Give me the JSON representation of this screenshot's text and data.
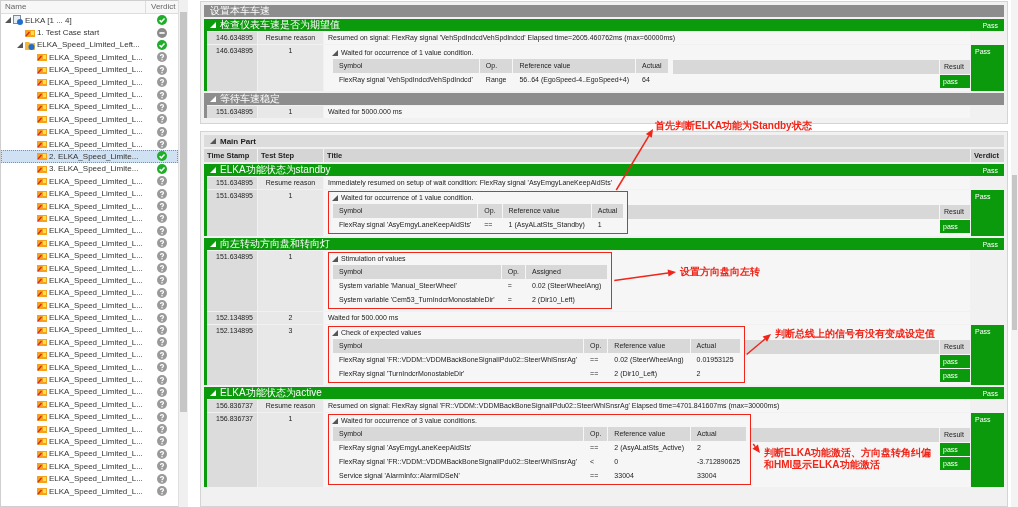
{
  "tree": {
    "columns": [
      "Name",
      "Verdict"
    ],
    "items": [
      {
        "label": "ELKA [1 ... 4]",
        "kind": "module",
        "verdict": {
          "kind": "pass"
        },
        "expanded": true,
        "selected": false,
        "children": [
          {
            "label": "1. Test Case start",
            "kind": "testcase",
            "verdict": {
              "kind": "none"
            },
            "selected": false
          },
          {
            "label": "ELKA_Speed_Limited_Left...",
            "kind": "group",
            "verdict": {
              "kind": "pass"
            },
            "expanded": true,
            "selected": false,
            "children": [
              {
                "label": "ELKA_Speed_Limited_L...",
                "kind": "testcase",
                "verdict": {
                  "kind": "unknown"
                },
                "selected": false
              },
              {
                "label": "ELKA_Speed_Limited_L...",
                "kind": "testcase",
                "verdict": {
                  "kind": "unknown"
                },
                "selected": false
              },
              {
                "label": "ELKA_Speed_Limited_L...",
                "kind": "testcase",
                "verdict": {
                  "kind": "unknown"
                },
                "selected": false
              },
              {
                "label": "ELKA_Speed_Limited_L...",
                "kind": "testcase",
                "verdict": {
                  "kind": "unknown"
                },
                "selected": false
              },
              {
                "label": "ELKA_Speed_Limited_L...",
                "kind": "testcase",
                "verdict": {
                  "kind": "unknown"
                },
                "selected": false
              },
              {
                "label": "ELKA_Speed_Limited_L...",
                "kind": "testcase",
                "verdict": {
                  "kind": "unknown"
                },
                "selected": false
              },
              {
                "label": "ELKA_Speed_Limited_L...",
                "kind": "testcase",
                "verdict": {
                  "kind": "unknown"
                },
                "selected": false
              },
              {
                "label": "ELKA_Speed_Limited_L...",
                "kind": "testcase",
                "verdict": {
                  "kind": "unknown"
                },
                "selected": false
              },
              {
                "label": "2. ELKA_Speed_Limite...",
                "kind": "testcase",
                "verdict": {
                  "kind": "pass"
                },
                "selected": true
              },
              {
                "label": "3. ELKA_Speed_Limite...",
                "kind": "testcase",
                "verdict": {
                  "kind": "pass"
                },
                "selected": false
              },
              {
                "label": "ELKA_Speed_Limited_L...",
                "kind": "testcase",
                "verdict": {
                  "kind": "unknown"
                },
                "selected": false
              },
              {
                "label": "ELKA_Speed_Limited_L...",
                "kind": "testcase",
                "verdict": {
                  "kind": "unknown"
                },
                "selected": false
              },
              {
                "label": "ELKA_Speed_Limited_L...",
                "kind": "testcase",
                "verdict": {
                  "kind": "unknown"
                },
                "selected": false
              },
              {
                "label": "ELKA_Speed_Limited_L...",
                "kind": "testcase",
                "verdict": {
                  "kind": "unknown"
                },
                "selected": false
              },
              {
                "label": "ELKA_Speed_Limited_L...",
                "kind": "testcase",
                "verdict": {
                  "kind": "unknown"
                },
                "selected": false
              },
              {
                "label": "ELKA_Speed_Limited_L...",
                "kind": "testcase",
                "verdict": {
                  "kind": "unknown"
                },
                "selected": false
              },
              {
                "label": "ELKA_Speed_Limited_L...",
                "kind": "testcase",
                "verdict": {
                  "kind": "unknown"
                },
                "selected": false
              },
              {
                "label": "ELKA_Speed_Limited_L...",
                "kind": "testcase",
                "verdict": {
                  "kind": "unknown"
                },
                "selected": false
              },
              {
                "label": "ELKA_Speed_Limited_L...",
                "kind": "testcase",
                "verdict": {
                  "kind": "unknown"
                },
                "selected": false
              },
              {
                "label": "ELKA_Speed_Limited_L...",
                "kind": "testcase",
                "verdict": {
                  "kind": "unknown"
                },
                "selected": false
              },
              {
                "label": "ELKA_Speed_Limited_L...",
                "kind": "testcase",
                "verdict": {
                  "kind": "unknown"
                },
                "selected": false
              },
              {
                "label": "ELKA_Speed_Limited_L...",
                "kind": "testcase",
                "verdict": {
                  "kind": "unknown"
                },
                "selected": false
              },
              {
                "label": "ELKA_Speed_Limited_L...",
                "kind": "testcase",
                "verdict": {
                  "kind": "unknown"
                },
                "selected": false
              },
              {
                "label": "ELKA_Speed_Limited_L...",
                "kind": "testcase",
                "verdict": {
                  "kind": "unknown"
                },
                "selected": false
              },
              {
                "label": "ELKA_Speed_Limited_L...",
                "kind": "testcase",
                "verdict": {
                  "kind": "unknown"
                },
                "selected": false
              },
              {
                "label": "ELKA_Speed_Limited_L...",
                "kind": "testcase",
                "verdict": {
                  "kind": "unknown"
                },
                "selected": false
              },
              {
                "label": "ELKA_Speed_Limited_L...",
                "kind": "testcase",
                "verdict": {
                  "kind": "unknown"
                },
                "selected": false
              },
              {
                "label": "ELKA_Speed_Limited_L...",
                "kind": "testcase",
                "verdict": {
                  "kind": "unknown"
                },
                "selected": false
              },
              {
                "label": "ELKA_Speed_Limited_L...",
                "kind": "testcase",
                "verdict": {
                  "kind": "unknown"
                },
                "selected": false
              },
              {
                "label": "ELKA_Speed_Limited_L...",
                "kind": "testcase",
                "verdict": {
                  "kind": "unknown"
                },
                "selected": false
              },
              {
                "label": "ELKA_Speed_Limited_L...",
                "kind": "testcase",
                "verdict": {
                  "kind": "unknown"
                },
                "selected": false
              },
              {
                "label": "ELKA_Speed_Limited_L...",
                "kind": "testcase",
                "verdict": {
                  "kind": "unknown"
                },
                "selected": false
              },
              {
                "label": "ELKA_Speed_Limited_L...",
                "kind": "testcase",
                "verdict": {
                  "kind": "unknown"
                },
                "selected": false
              },
              {
                "label": "ELKA_Speed_Limited_L...",
                "kind": "testcase",
                "verdict": {
                  "kind": "unknown"
                },
                "selected": false
              },
              {
                "label": "ELKA_Speed_Limited_L...",
                "kind": "testcase",
                "verdict": {
                  "kind": "unknown"
                },
                "selected": false
              },
              {
                "label": "ELKA_Speed_Limited_L...",
                "kind": "testcase",
                "verdict": {
                  "kind": "unknown"
                },
                "selected": false
              }
            ]
          }
        ]
      }
    ]
  },
  "report": {
    "top_sections": [
      {
        "title": "设置本车车速"
      },
      {
        "title": "检查仪表车速是否为期望值",
        "verdict": "Pass",
        "expanded": true,
        "rows": [
          {
            "kind": "info",
            "time": "146.634895",
            "step": "Resume reason",
            "title": "Resumed on signal: FlexRay signal 'VehSpdIndcdVehSpdIndcd' Elapsed time=2605.460762ms (max=60000ms)"
          },
          {
            "kind": "check",
            "time": "146.634895",
            "step": "1",
            "caption": "Waited for occurrence of 1 value condition.",
            "expanded": true,
            "verdict": "Pass",
            "table": {
              "columns": [
                "Symbol",
                "Op.",
                "Reference value",
                "Actual"
              ],
              "result_column": "Result",
              "rows": [
                {
                  "cells": [
                    "FlexRay signal 'VehSpdIndcdVehSpdIndcd'",
                    "Range",
                    "56..64 (EgoSpeed-4..EgoSpeed+4)",
                    "64"
                  ],
                  "result": "pass"
                }
              ]
            }
          }
        ]
      },
      {
        "title": "等待车速稳定",
        "expanded": true,
        "rows": [
          {
            "kind": "info",
            "time": "151.634895",
            "step": "1",
            "title": "Waited for 5000.000 ms"
          }
        ]
      }
    ],
    "main_part": {
      "title": "Main Part",
      "expanded": true,
      "columns": [
        "Time Stamp",
        "Test Step",
        "Title",
        "Verdict"
      ],
      "sections": [
        {
          "title": "ELKA功能状态为standby",
          "verdict": "Pass",
          "expanded": true,
          "rows": [
            {
              "kind": "info",
              "time": "151.634895",
              "step": "Resume reason",
              "title": "Immediately resumed on setup of wait condition: FlexRay signal 'AsyEmgyLaneKeepAidSts'"
            },
            {
              "kind": "check",
              "time": "151.634895",
              "step": "1",
              "caption": "Waited for occurrence of 1 value condition.",
              "expanded": true,
              "verdict": "Pass",
              "note": {
                "text": "首先判断ELKA功能为Standby状态"
              },
              "table": {
                "columns": [
                  "Symbol",
                  "Op.",
                  "Reference value",
                  "Actual"
                ],
                "result_column": "Result",
                "rows": [
                  {
                    "cells": [
                      "FlexRay signal 'AsyEmgyLaneKeepAidSts'",
                      "==",
                      "1 (AsyALatSts_Standby)",
                      "1"
                    ],
                    "result": "pass"
                  }
                ]
              }
            }
          ]
        },
        {
          "title": "向左转动方向盘和转向灯",
          "verdict": "Pass",
          "expanded": true,
          "rows": [
            {
              "kind": "check",
              "time": "151.634895",
              "step": "1",
              "caption": "Stimulation of values",
              "expanded": true,
              "note": {
                "text": "设置方向盘向左转"
              },
              "table": {
                "columns": [
                  "Symbol",
                  "Op.",
                  "Assigned"
                ],
                "rows": [
                  {
                    "cells": [
                      "System variable 'Manual_SteerWheel'",
                      "=",
                      "0.02 (SteerWheelAng)"
                    ]
                  },
                  {
                    "cells": [
                      "System variable 'Cem53_TurnIndcrMonostableDir'",
                      "=",
                      "2 (Dir10_Left)"
                    ]
                  }
                ]
              }
            },
            {
              "kind": "info",
              "time": "152.134895",
              "step": "2",
              "title": "Waited for 500.000 ms"
            },
            {
              "kind": "check",
              "time": "152.134895",
              "step": "3",
              "caption": "Check of expected values",
              "expanded": true,
              "verdict": "Pass",
              "note": {
                "text": "判断总线上的信号有没有变成设定值"
              },
              "table": {
                "columns": [
                  "Symbol",
                  "Op.",
                  "Reference value",
                  "Actual"
                ],
                "result_column": "Result",
                "rows": [
                  {
                    "cells": [
                      "FlexRay signal 'FR::VDDM::VDDMBackBoneSignalIPdu02::SteerWhlSnsrAg'",
                      "==",
                      "0.02 (SteerWheelAng)",
                      "0.01953125"
                    ],
                    "result": "pass"
                  },
                  {
                    "cells": [
                      "FlexRay signal 'TurnIndcrMonostableDir'",
                      "==",
                      "2 (Dir10_Left)",
                      "2"
                    ],
                    "result": "pass"
                  }
                ]
              }
            }
          ]
        },
        {
          "title": "ELKA功能状态为active",
          "verdict": "Pass",
          "expanded": true,
          "rows": [
            {
              "kind": "info",
              "time": "156.836737",
              "step": "Resume reason",
              "title": "Resumed on signal: FlexRay signal 'FR::VDDM::VDDMBackBoneSignalIPdu02::SteerWhlSnsrAg' Elapsed time=4701.841607ms (max=30000ms)"
            },
            {
              "kind": "check",
              "time": "156.836737",
              "step": "1",
              "caption": "Waited for occurrence of 3 value conditions.",
              "expanded": true,
              "verdict": "Pass",
              "note": {
                "text": "判断ELKA功能激活、方向盘转角纠偏和HMI显示ELKA功能激活"
              },
              "table": {
                "columns": [
                  "Symbol",
                  "Op.",
                  "Reference value",
                  "Actual"
                ],
                "result_column": "Result",
                "rows": [
                  {
                    "cells": [
                      "FlexRay signal 'AsyEmgyLaneKeepAidSts'",
                      "==",
                      "2 (AsyALatSts_Active)",
                      "2"
                    ],
                    "result": "pass"
                  },
                  {
                    "cells": [
                      "FlexRay signal 'FR::VDDM::VDDMBackBoneSignalIPdu02::SteerWhlSnsrAg'",
                      "<",
                      "0",
                      "-3.712890625"
                    ],
                    "result": "pass"
                  },
                  {
                    "cells": [
                      "Service signal 'AlarmInfo::AlarmIDSeN'",
                      "==",
                      "33004",
                      "33004"
                    ]
                  }
                ]
              }
            }
          ]
        }
      ]
    }
  }
}
